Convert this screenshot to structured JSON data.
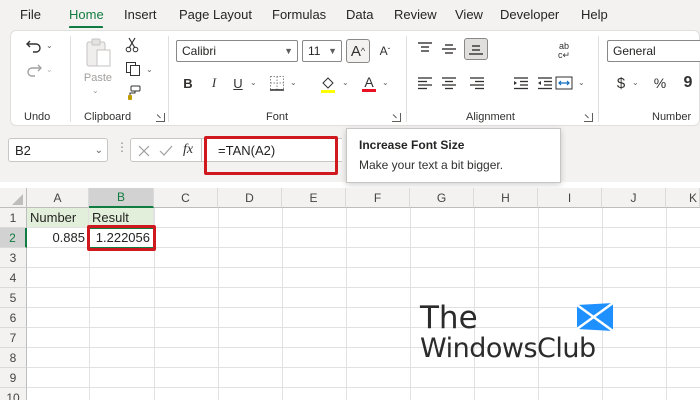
{
  "menu": [
    "File",
    "Home",
    "Insert",
    "Page Layout",
    "Formulas",
    "Data",
    "Review",
    "View",
    "Developer",
    "Help"
  ],
  "ribbon": {
    "groups": {
      "undo": "Undo",
      "clipboard": "Clipboard",
      "font": "Font",
      "alignment": "Alignment",
      "number": "Number"
    },
    "paste_label": "Paste",
    "font_name": "Calibri",
    "font_size": "11",
    "number_format": "General",
    "font_color": "#e81123"
  },
  "formula_bar": {
    "name_box": "B2",
    "fx_icon": "fx",
    "formula": "=TAN(A2)"
  },
  "tooltip": {
    "title": "Increase Font Size",
    "body": "Make your text a bit bigger."
  },
  "sheet": {
    "columns": [
      "A",
      "B",
      "C",
      "D",
      "E",
      "F",
      "G",
      "H",
      "I",
      "J",
      "K"
    ],
    "rows": [
      "1",
      "2",
      "3",
      "4",
      "5",
      "6",
      "7",
      "8",
      "9",
      "10"
    ],
    "cells": {
      "A1": "Number",
      "B1": "Result",
      "A2": "0.885",
      "B2": "1.222056"
    },
    "selected_cell": "B2"
  },
  "watermark": {
    "line1": "The",
    "line2": "WindowsClub"
  },
  "colors": {
    "accent": "#107c41",
    "highlight_box": "#d0191f",
    "header_fill": "#e2efda",
    "logo_blue": "#1e90ff"
  }
}
